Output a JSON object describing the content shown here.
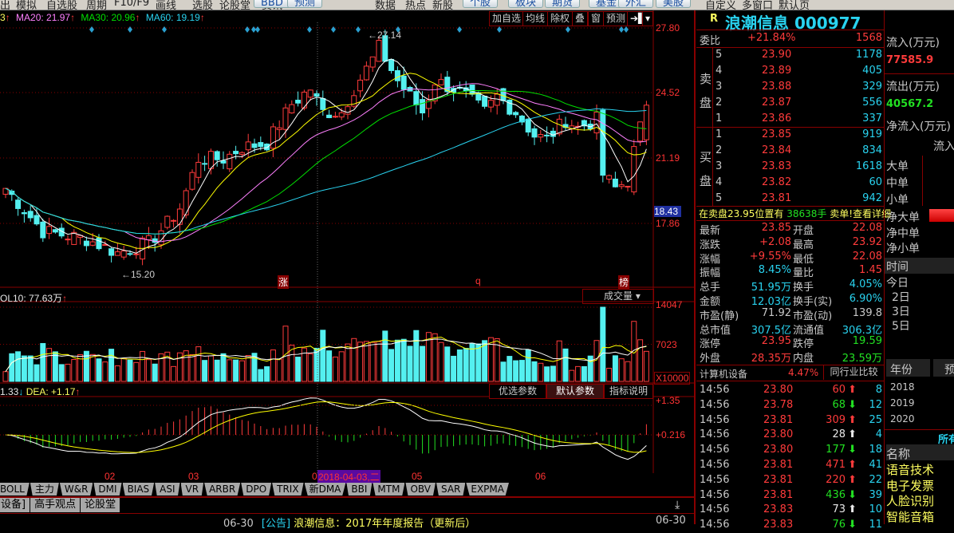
{
  "menubar": {
    "items": [
      "出",
      "模拟",
      "自选股",
      "周期",
      "F10/F9",
      "画线",
      "选股",
      "论股堂",
      "资讯",
      "数据",
      "热点",
      "新股",
      "自定义",
      "多窗口",
      "默认页"
    ],
    "buttons": [
      "BBD",
      "预测",
      "个股",
      "板块",
      "期货",
      "基金",
      "外汇",
      "美股"
    ]
  },
  "ma_legend": {
    "ma10_partial": "3",
    "ma20": "MA20: 21.97",
    "ma30": "MA30: 20.96",
    "ma60": "MA60: 19.19",
    "up_arrow": "↑"
  },
  "toolbar": {
    "add_watch": "加自选",
    "ma": "均线",
    "exright": "除权",
    "overlay": "叠",
    "window": "窗",
    "forecast": "预测",
    "next": "➔▌",
    "dropdown": "▾"
  },
  "price_axis": [
    "27.80",
    "24.52",
    "21.19",
    "18.43",
    "17.86"
  ],
  "annotations": {
    "high": "27.14",
    "low": "15.20",
    "marks": [
      "涨",
      "q",
      "榜"
    ]
  },
  "volume": {
    "legend": "OL10: 77.63万",
    "selector": "成交量",
    "axis": [
      "14047",
      "7023",
      "X10000"
    ]
  },
  "macd": {
    "legend_dif": "1.33",
    "legend_dea": "DEA: +1.17",
    "buttons": [
      "优选参数",
      "默认参数",
      "指标说明"
    ],
    "axis": [
      "+1.35",
      "+0.216"
    ]
  },
  "date_axis": {
    "labels": [
      "02",
      "03",
      "0",
      "05",
      "06"
    ],
    "cursor_date": "2018-04-03,二"
  },
  "indicator_tabs": [
    "BOLL",
    "主力",
    "W&R",
    "DMI",
    "BIAS",
    "ASI",
    "VR",
    "ARBR",
    "DPO",
    "TRIX",
    "新DMA",
    "BBI",
    "MTM",
    "OBV",
    "SAR",
    "EXPMA"
  ],
  "bottom_tabs": [
    "设备]",
    "高手观点",
    "论股堂"
  ],
  "news": {
    "date": "06-30",
    "tag": "[公告]",
    "title": "浪潮信息：2017年年度报告（更新后）",
    "date2": "06-30"
  },
  "quote": {
    "flag": "R",
    "name": "浪潮信息",
    "code": "000977",
    "weibi_label": "委比",
    "weibi": "+21.84%",
    "weibi_vol": "1568",
    "sell_label": [
      "卖",
      "盘"
    ],
    "buy_label": [
      "买",
      "盘"
    ],
    "sell": [
      {
        "lvl": "5",
        "price": "23.90",
        "vol": "1178"
      },
      {
        "lvl": "4",
        "price": "23.89",
        "vol": "405"
      },
      {
        "lvl": "3",
        "price": "23.88",
        "vol": "329"
      },
      {
        "lvl": "2",
        "price": "23.87",
        "vol": "556"
      },
      {
        "lvl": "1",
        "price": "23.86",
        "vol": "337"
      }
    ],
    "buy": [
      {
        "lvl": "1",
        "price": "23.85",
        "vol": "919"
      },
      {
        "lvl": "2",
        "price": "23.84",
        "vol": "834"
      },
      {
        "lvl": "3",
        "price": "23.83",
        "vol": "1618"
      },
      {
        "lvl": "4",
        "price": "23.82",
        "vol": "60"
      },
      {
        "lvl": "5",
        "price": "23.81",
        "vol": "942"
      }
    ],
    "alert": {
      "a": "在卖盘23.95位置有",
      "b": "38638手",
      "c": "卖单!查看详细"
    },
    "stats": [
      [
        "最新",
        "23.85",
        "red",
        "开盘",
        "22.08",
        "red"
      ],
      [
        "涨跌",
        "+2.08",
        "red",
        "最高",
        "23.92",
        "red"
      ],
      [
        "涨幅",
        "+9.55%",
        "red",
        "最低",
        "22.08",
        "red"
      ],
      [
        "振幅",
        "8.45%",
        "cy",
        "量比",
        "1.45",
        "red"
      ],
      [
        "总手",
        "51.95万",
        "cy",
        "换手",
        "4.05%",
        "cy"
      ],
      [
        "金额",
        "12.03亿",
        "cy",
        "换手(实)",
        "6.90%",
        "cy"
      ],
      [
        "市盈(静)",
        "71.92",
        "gy",
        "市盈(动)",
        "139.8",
        "gy"
      ],
      [
        "总市值",
        "307.5亿",
        "cy",
        "流通值",
        "306.3亿",
        "cy"
      ],
      [
        "涨停",
        "23.95",
        "red",
        "跌停",
        "19.59",
        "gr"
      ],
      [
        "外盘",
        "28.35万",
        "red",
        "内盘",
        "23.59万",
        "gr"
      ]
    ],
    "industry": "计算机设备",
    "industry_pct": "4.47%",
    "compare_btn": "同行业比较"
  },
  "ticks": [
    [
      "14:56",
      "23.80",
      "60",
      "up",
      "red",
      "8"
    ],
    [
      "14:56",
      "23.78",
      "68",
      "down",
      "gr",
      "12"
    ],
    [
      "14:56",
      "23.81",
      "309",
      "up",
      "red",
      "25"
    ],
    [
      "14:56",
      "23.80",
      "28",
      "up",
      "wh",
      "4"
    ],
    [
      "14:56",
      "23.80",
      "177",
      "down",
      "gr",
      "18"
    ],
    [
      "14:56",
      "23.81",
      "471",
      "up",
      "red",
      "41"
    ],
    [
      "14:56",
      "23.81",
      "220",
      "up",
      "red",
      "22"
    ],
    [
      "14:56",
      "23.81",
      "436",
      "down",
      "gr",
      "39"
    ],
    [
      "14:56",
      "23.83",
      "73",
      "up",
      "wh",
      "10"
    ],
    [
      "14:56",
      "23.83",
      "76",
      "down",
      "gr",
      "11"
    ]
  ],
  "flow": {
    "in_label": "流入(万元)",
    "in": "77585.9",
    "out_label": "流出(万元)",
    "out": "40567.2",
    "net_label": "净流入(万元)",
    "col": "流入",
    "rows": [
      "大单",
      "中单",
      "小单"
    ],
    "net_rows": [
      "净大单",
      "净中单",
      "净小单"
    ],
    "time_label": "时间",
    "periods": [
      "今日",
      "2日",
      "3日",
      "5日"
    ],
    "year_label": "年份",
    "forecast": "预",
    "years": [
      "2018",
      "2019",
      "2020"
    ],
    "all": "所有",
    "name_label": "名称",
    "concepts": [
      "语音技术",
      "电子发票",
      "人脸识别",
      "智能音箱"
    ]
  },
  "chart_data": {
    "type": "candlestick",
    "ylim": [
      15.0,
      27.9
    ],
    "n": 104,
    "keypoints": [
      [
        0,
        19.6
      ],
      [
        6,
        17.4
      ],
      [
        13,
        17.0
      ],
      [
        18,
        16.3
      ],
      [
        23,
        16.8
      ],
      [
        26,
        17.8
      ],
      [
        28,
        18.6
      ],
      [
        31,
        21.1
      ],
      [
        35,
        21.1
      ],
      [
        38,
        21.7
      ],
      [
        42,
        21.9
      ],
      [
        46,
        23.9
      ],
      [
        49,
        24.7
      ],
      [
        51,
        23.5
      ],
      [
        54,
        23.5
      ],
      [
        56,
        24.7
      ],
      [
        59,
        26.2
      ],
      [
        60,
        26.8
      ],
      [
        63,
        25.1
      ],
      [
        67,
        23.5
      ],
      [
        69,
        25.1
      ],
      [
        72,
        24.7
      ],
      [
        74,
        24.3
      ],
      [
        77,
        23.5
      ],
      [
        79,
        24.3
      ],
      [
        82,
        23.5
      ],
      [
        85,
        22.3
      ],
      [
        87,
        22.1
      ],
      [
        90,
        23.1
      ],
      [
        92,
        22.7
      ],
      [
        95,
        23.1
      ],
      [
        96,
        20.3
      ],
      [
        98,
        19.6
      ],
      [
        100,
        20.0
      ],
      [
        101,
        21.5
      ],
      [
        103,
        23.85
      ]
    ],
    "volume_max": 14047,
    "colors": {
      "up": "#ff3b3b",
      "down": "#54f0f0",
      "ma5": "#ffffff",
      "ma10": "#ffff00",
      "ma20": "#ff80ff",
      "ma30": "#00e000",
      "ma60": "#29d3f0"
    }
  }
}
